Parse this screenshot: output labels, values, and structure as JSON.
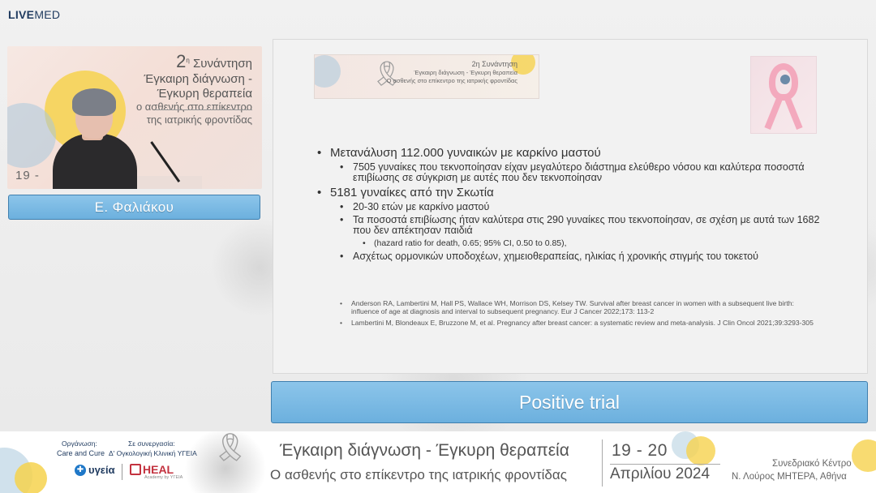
{
  "brand": {
    "logo_bold": "LIVE",
    "logo_light": "MED"
  },
  "video": {
    "title_num": "2",
    "title_sup": "η",
    "title_word": "Συνάντηση",
    "title_line2": "Έγκαιρη διάγνωση -",
    "title_line3": "Έγκυρη θεραπεία",
    "title_line4": "ο ασθενής στο επίκεντρο",
    "title_line5": "της ιατρικής φροντίδας",
    "date_partial": "19 -"
  },
  "speaker": {
    "name": "Ε. Φαλιάκου"
  },
  "slide": {
    "banner": {
      "line1": "2η Συνάντηση",
      "line2": "Έγκαιρη διάγνωση - Έγκυρη θεραπεία",
      "line3": "Ο ασθενής στο επίκεντρο της ιατρικής φροντίδας"
    },
    "bullet1": "Μετανάλυση 112.000 γυναικών με καρκίνο μαστού",
    "bullet1_sub1": "7505 γυναίκες που τεκνοποίησαν είχαν μεγαλύτερο διάστημα ελεύθερο νόσου και καλύτερα ποσοστά επιβίωσης σε σύγκριση με αυτές που δεν τεκνοποίησαν",
    "bullet2": "5181 γυναίκες από την Σκωτία",
    "bullet2_sub1": "20-30 ετών με καρκίνο μαστού",
    "bullet2_sub2": "Τα ποσοστά επιβίωσης ήταν καλύτερα στις 290 γυναίκες που τεκνοποίησαν, σε σχέση με αυτά των 1682 που δεν απέκτησαν παιδιά",
    "bullet2_sub2_detail": "(hazard ratio for death, 0.65; 95% CI, 0.50 to 0.85),",
    "bullet2_sub3": "Ασχέτως ορμονικών υποδοχέων, χημειοθεραπείας, ηλικίας ή χρονικής στιγμής του τοκετού",
    "ref1": "Anderson RA, Lambertini M, Hall PS, Wallace WH, Morrison DS, Kelsey TW. Survival after breast cancer in women with a subsequent live birth: influence of age at diagnosis and interval to subsequent pregnancy. Eur J Cancer 2022;173: 113-2",
    "ref2": "Lambertini M, Blondeaux E, Bruzzone M, et al. Pregnancy after breast cancer: a systematic review and meta-analysis. J Clin Oncol 2021;39:3293-305"
  },
  "caption": {
    "text": "Positive trial"
  },
  "footer": {
    "org_label": "Οργάνωση:",
    "org_value": "Care and Cure",
    "coop_label": "Σε συνεργασία:",
    "coop_value": "Δ' Ογκολογική Κλινική ΥΓΕΙΑ",
    "ygeia_logo": "υγεία",
    "heal_logo": "HEAL",
    "heal_sub": "Academy by ΥΓΕΙΑ",
    "title1": "Έγκαιρη διάγνωση - Έγκυρη θεραπεία",
    "title2": "Ο ασθενής στο επίκεντρο της ιατρικής φροντίδας",
    "date1": "19 - 20",
    "date2": "Απριλίου 2024",
    "venue1": "Συνεδριακό Κέντρο",
    "venue2": "Ν. Λούρος ΜΗΤΕΡΑ, Αθήνα"
  },
  "colors": {
    "accent_blue": "#6cb0de",
    "accent_yellow": "#f6d24d",
    "brand_navy": "#1f3a5f",
    "heal_red": "#c3323f"
  }
}
